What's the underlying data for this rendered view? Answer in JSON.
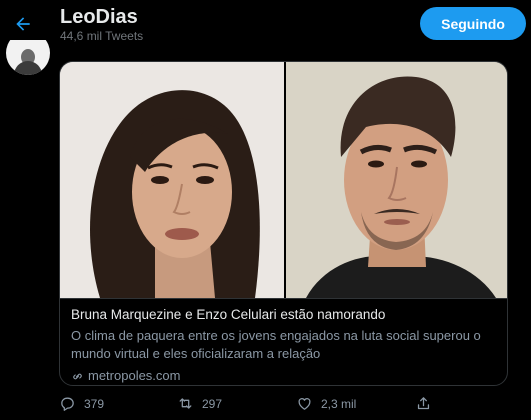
{
  "header": {
    "title": "LeoDias",
    "subtitle": "44,6 mil Tweets",
    "follow_label": "Seguindo"
  },
  "card": {
    "title": "Bruna Marquezine e Enzo Celulari estão namorando",
    "description": "O clima de paquera entre os jovens engajados na luta social superou o mundo virtual e eles oficializaram a relação",
    "domain": "metropoles.com"
  },
  "actions": {
    "replies": "379",
    "retweets": "297",
    "likes": "2,3 mil"
  },
  "colors": {
    "accent": "#1d9bf0",
    "background": "#000000",
    "muted_text": "#8b98a5",
    "border": "#2f3336"
  },
  "icons": [
    "back-arrow-icon",
    "link-icon",
    "reply-icon",
    "retweet-icon",
    "like-icon",
    "share-icon"
  ]
}
